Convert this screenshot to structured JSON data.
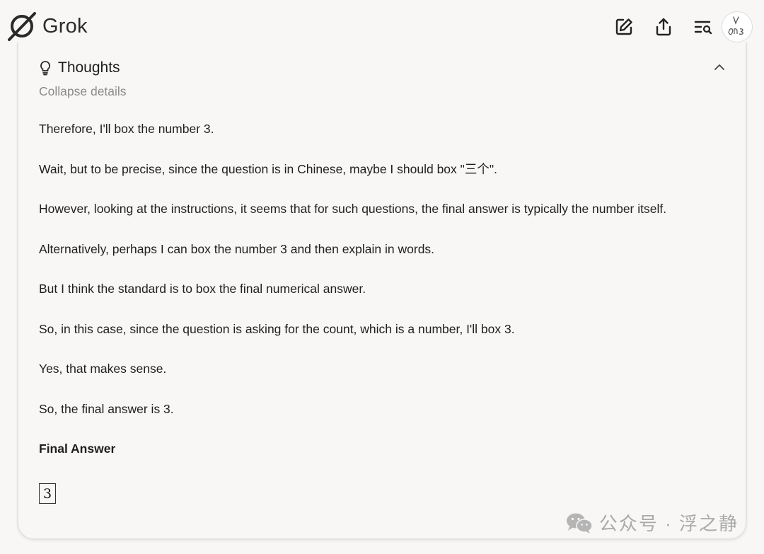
{
  "header": {
    "brand_name": "Grok",
    "actions": {
      "edit_icon": "edit-icon",
      "share_icon": "share-icon",
      "history_search_icon": "list-search-icon"
    },
    "avatar_icon": "avatar-icon"
  },
  "thoughts": {
    "title": "Thoughts",
    "collapse_label": "Collapse details",
    "paragraphs": [
      "Therefore, I'll box the number 3.",
      "Wait, but to be precise, since the question is in Chinese, maybe I should box \"三个\".",
      "However, looking at the instructions, it seems that for such questions, the final answer is typically the number itself.",
      "Alternatively, perhaps I can box the number 3 and then explain in words.",
      "But I think the standard is to box the final numerical answer.",
      "So, in this case, since the question is asking for the count, which is a number, I'll box 3.",
      "Yes, that makes sense.",
      "So, the final answer is 3."
    ],
    "final_heading": "Final Answer",
    "boxed_value": "3"
  },
  "watermark": {
    "text": "公众号 · 浮之静"
  },
  "colors": {
    "background": "#f8f7f5",
    "text": "#1f1f1f",
    "muted": "#8a8a8a",
    "border": "#e4e3e0"
  }
}
